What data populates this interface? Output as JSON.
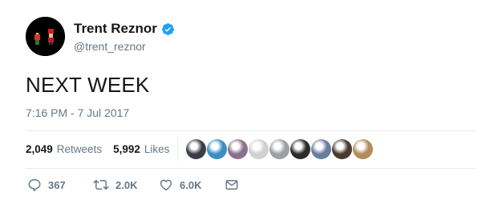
{
  "user": {
    "display_name": "Trent Reznor",
    "username": "@trent_reznor",
    "verified_icon": "verified-badge-icon",
    "verified_color": "#1da1f2"
  },
  "tweet": {
    "text": "NEXT WEEK",
    "timestamp": "7:16 PM - 7 Jul 2017"
  },
  "stats": {
    "retweets_count": "2,049",
    "retweets_label": "Retweets",
    "likes_count": "5,992",
    "likes_label": "Likes"
  },
  "liked_by_avatars": [
    {
      "icon": "liker-avatar-1",
      "color": "#3b3f45"
    },
    {
      "icon": "liker-avatar-2",
      "color": "#3a8fc2"
    },
    {
      "icon": "liker-avatar-3",
      "color": "#8a6f8e"
    },
    {
      "icon": "liker-avatar-4",
      "color": "#d0d0d0"
    },
    {
      "icon": "liker-avatar-5",
      "color": "#9aa0a6"
    },
    {
      "icon": "liker-avatar-6",
      "color": "#2b2b2b"
    },
    {
      "icon": "liker-avatar-7",
      "color": "#6a7d9c"
    },
    {
      "icon": "liker-avatar-8",
      "color": "#4a3a30"
    },
    {
      "icon": "liker-avatar-9",
      "color": "#b08d5a"
    }
  ],
  "actions": {
    "reply_count": "367",
    "retweet_count": "2.0K",
    "like_count": "6.0K",
    "reply_icon": "reply-icon",
    "retweet_icon": "retweet-icon",
    "like_icon": "heart-icon",
    "dm_icon": "envelope-icon"
  }
}
